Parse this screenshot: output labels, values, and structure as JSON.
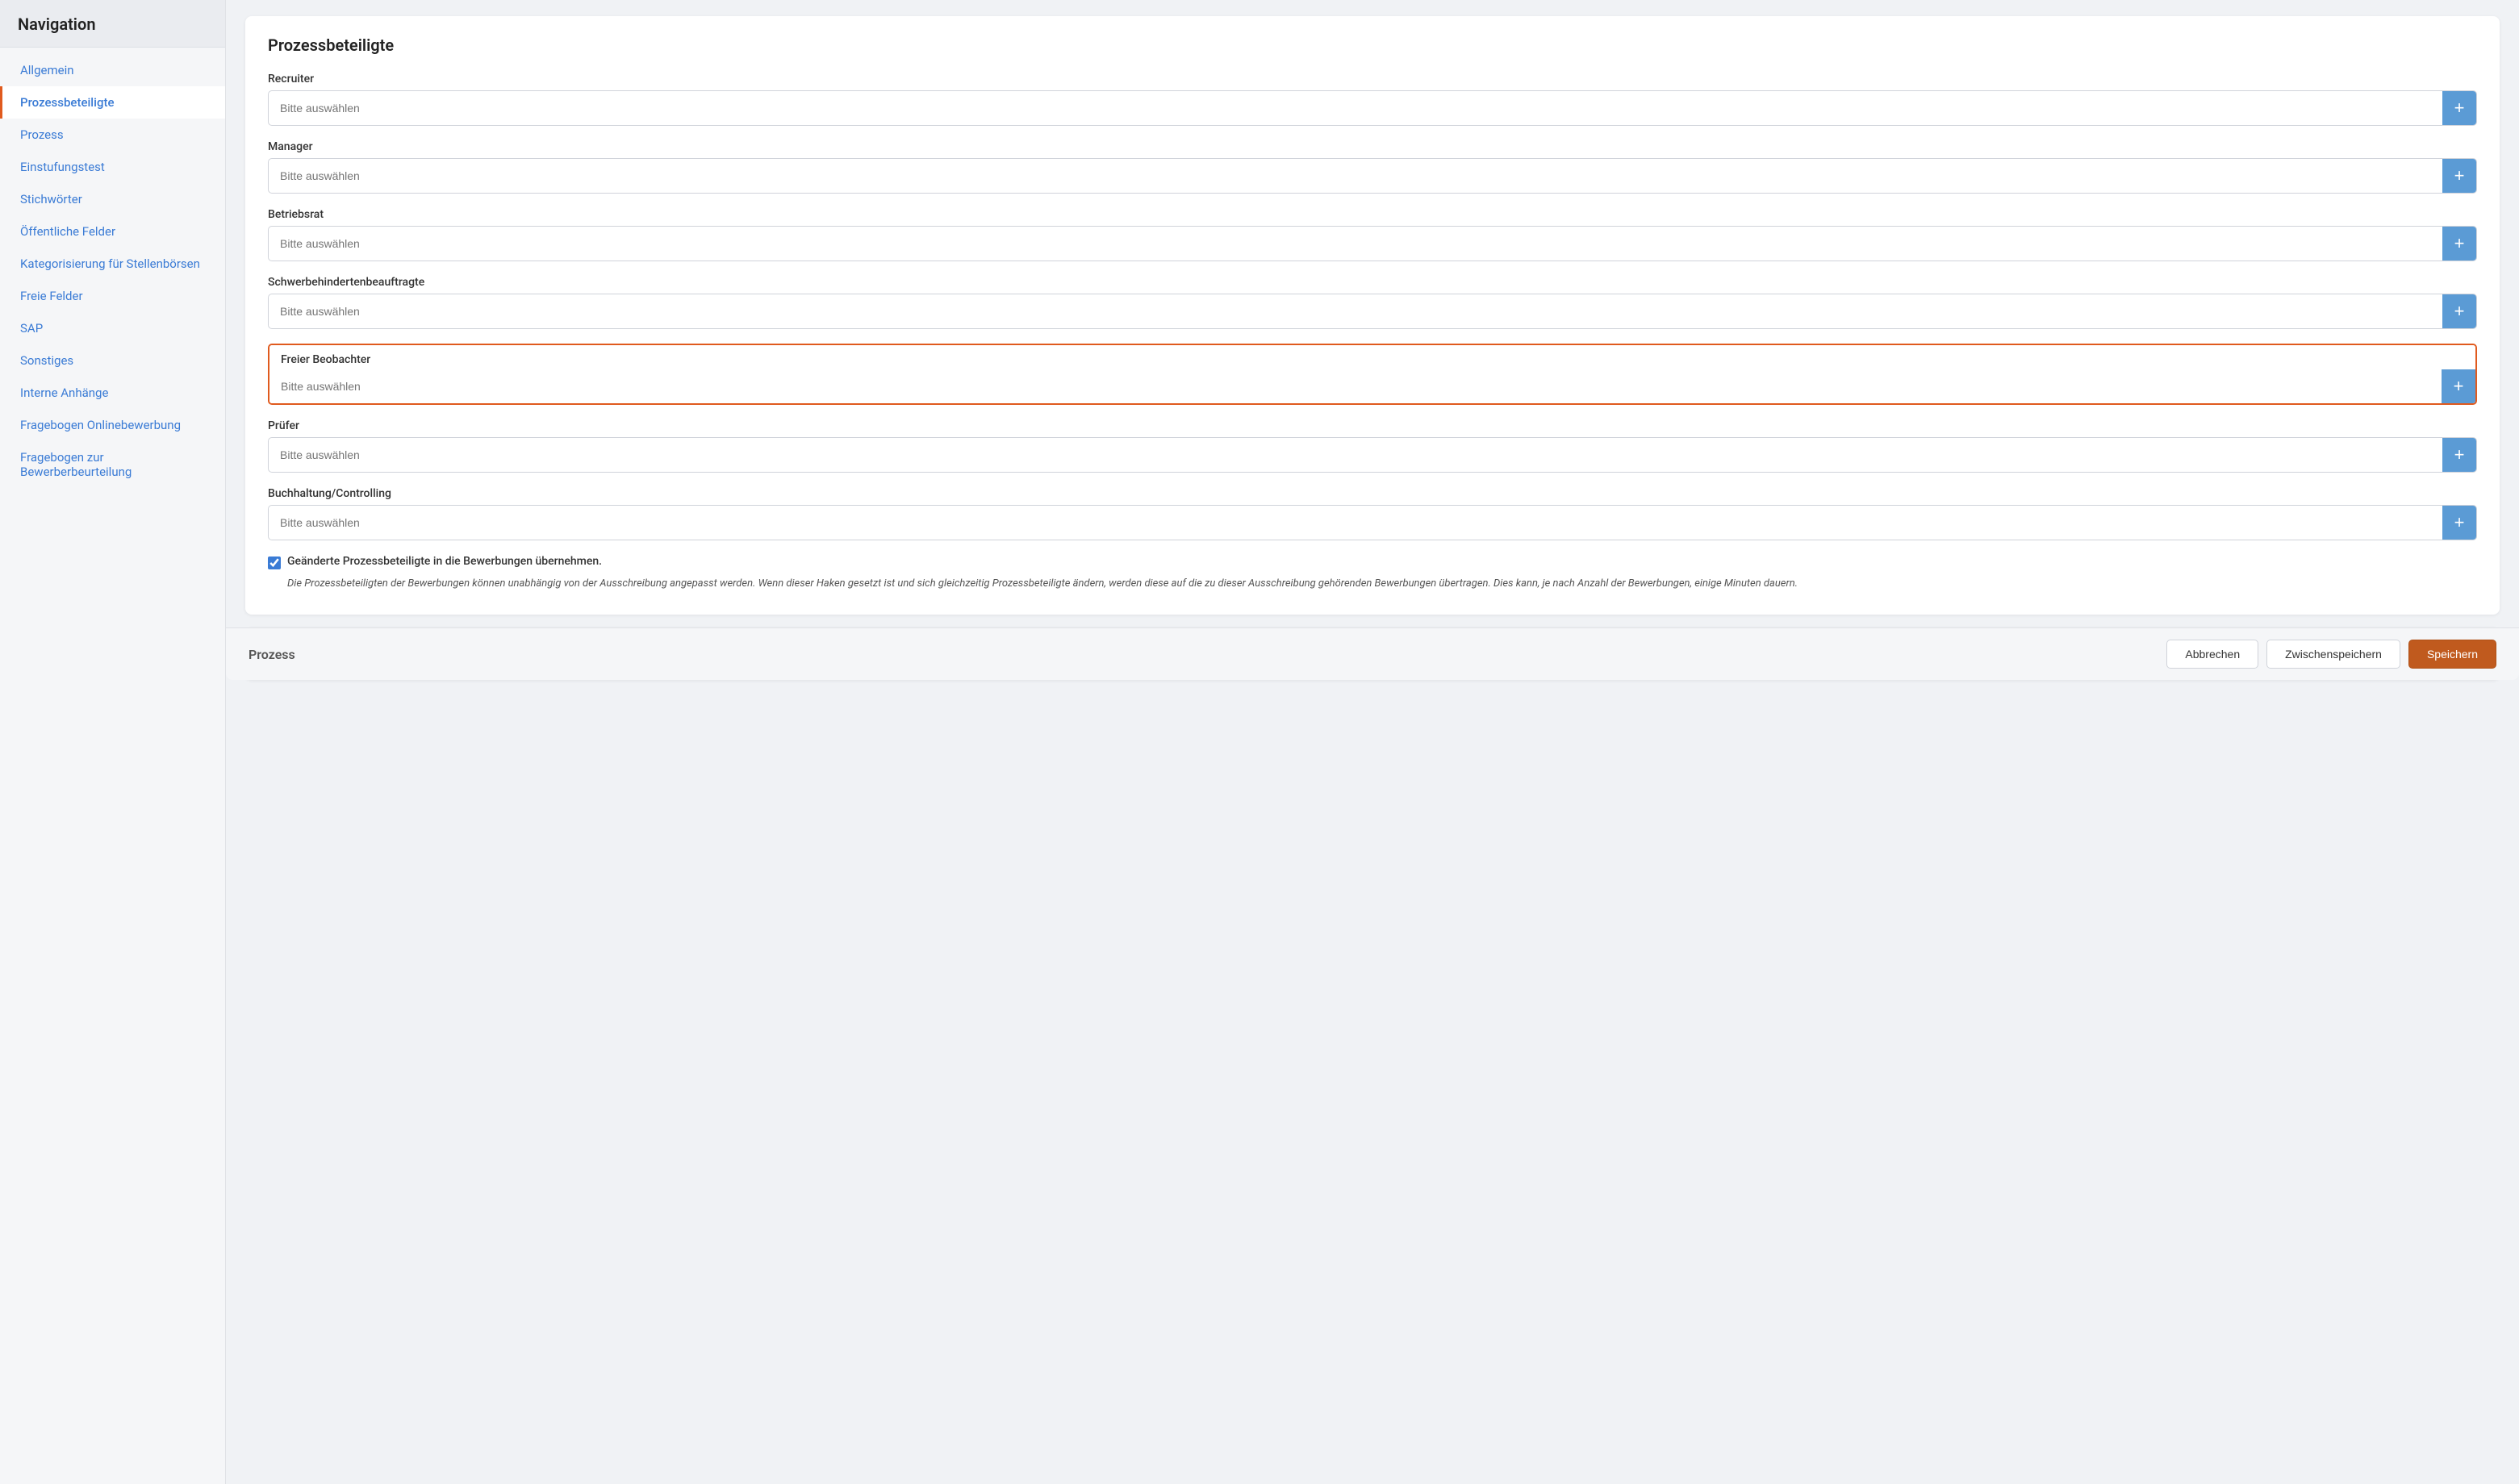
{
  "sidebar": {
    "title": "Navigation",
    "items": [
      {
        "id": "allgemein",
        "label": "Allgemein",
        "active": false
      },
      {
        "id": "prozessbeteiligte",
        "label": "Prozessbeteiligte",
        "active": true
      },
      {
        "id": "prozess",
        "label": "Prozess",
        "active": false
      },
      {
        "id": "einstufungstest",
        "label": "Einstufungstest",
        "active": false
      },
      {
        "id": "stichwoerter",
        "label": "Stichwörter",
        "active": false
      },
      {
        "id": "oeffentliche-felder",
        "label": "Öffentliche Felder",
        "active": false
      },
      {
        "id": "kategorisierung",
        "label": "Kategorisierung für Stellenbörsen",
        "active": false
      },
      {
        "id": "freie-felder",
        "label": "Freie Felder",
        "active": false
      },
      {
        "id": "sap",
        "label": "SAP",
        "active": false
      },
      {
        "id": "sonstiges",
        "label": "Sonstiges",
        "active": false
      },
      {
        "id": "interne-anhaenge",
        "label": "Interne Anhänge",
        "active": false
      },
      {
        "id": "fragebogen-onlinebewerbung",
        "label": "Fragebogen Onlinebewerbung",
        "active": false
      },
      {
        "id": "fragebogen-bewerberbeurteilung",
        "label": "Fragebogen zur Bewerberbeurteilung",
        "active": false
      }
    ]
  },
  "main": {
    "card_title": "Prozessbeteiligte",
    "fields": [
      {
        "id": "recruiter",
        "label": "Recruiter",
        "placeholder": "Bitte auswählen",
        "highlighted": false
      },
      {
        "id": "manager",
        "label": "Manager",
        "placeholder": "Bitte auswählen",
        "highlighted": false
      },
      {
        "id": "betriebsrat",
        "label": "Betriebsrat",
        "placeholder": "Bitte auswählen",
        "highlighted": false
      },
      {
        "id": "schwerbehindertenbeauftragte",
        "label": "Schwerbehindertenbeauftragte",
        "placeholder": "Bitte auswählen",
        "highlighted": false
      },
      {
        "id": "freier-beobachter",
        "label": "Freier Beobachter",
        "placeholder": "Bitte auswählen",
        "highlighted": true
      },
      {
        "id": "pruefer",
        "label": "Prüfer",
        "placeholder": "Bitte auswählen",
        "highlighted": false
      },
      {
        "id": "buchhaltung-controlling",
        "label": "Buchhaltung/Controlling",
        "placeholder": "Bitte auswählen",
        "highlighted": false
      }
    ],
    "checkbox": {
      "checked": true,
      "label": "Geänderte Prozessbeteiligte in die Bewerbungen übernehmen.",
      "description": "Die Prozessbeteiligten der Bewerbungen können unabhängig von der Ausschreibung angepasst werden. Wenn dieser Haken gesetzt ist und sich gleichzeitig Prozessbeteiligte ändern, werden diese auf die zu dieser Ausschreibung gehörenden Bewerbungen übertragen. Dies kann, je nach Anzahl der Bewerbungen, einige Minuten dauern."
    }
  },
  "bottom_bar": {
    "title": "Prozess",
    "btn_cancel": "Abbrechen",
    "btn_save_intermediate": "Zwischenspeichern",
    "btn_save": "Speichern"
  },
  "icons": {
    "plus": "+"
  }
}
